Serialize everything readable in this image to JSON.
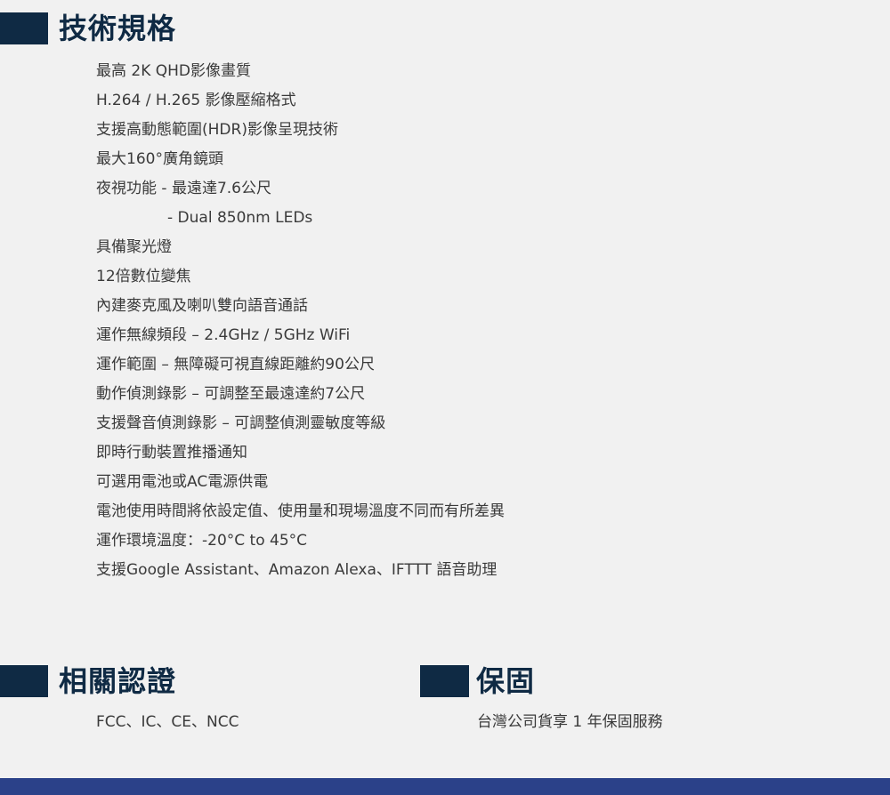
{
  "specs": {
    "title": "技術規格",
    "items": [
      "最高 2K QHD影像畫質",
      "H.264 / H.265 影像壓縮格式",
      "支援高動態範圍(HDR)影像呈現技術",
      "最大160°廣角鏡頭",
      "夜視功能 - 最遠達7.6公尺",
      "- Dual 850nm LEDs",
      "具備聚光燈",
      "12倍數位變焦",
      "內建麥克風及喇叭雙向語音通話",
      "運作無線頻段 – 2.4GHz / 5GHz WiFi",
      "運作範圍 – 無障礙可視直線距離約90公尺",
      "動作偵測錄影 – 可調整至最遠達約7公尺",
      "支援聲音偵測錄影 – 可調整偵測靈敏度等級",
      "即時行動裝置推播通知",
      "可選用電池或AC電源供電",
      "電池使用時間將依設定值、使用量和現場溫度不同而有所差異",
      "運作環境溫度：-20°C to 45°C",
      "支援Google Assistant、Amazon Alexa、IFTTT 語音助理"
    ]
  },
  "certification": {
    "title": "相關認證",
    "text": "FCC、IC、CE、NCC"
  },
  "warranty": {
    "title": "保固",
    "text": "台灣公司貨享 1 年保固服務"
  },
  "colors": {
    "heading_bar": "#0f2a44",
    "heading_text": "#0f2a44",
    "body_text": "#3a3a3a",
    "background": "#f1f1f1",
    "footer_bar": "#2b4189"
  }
}
